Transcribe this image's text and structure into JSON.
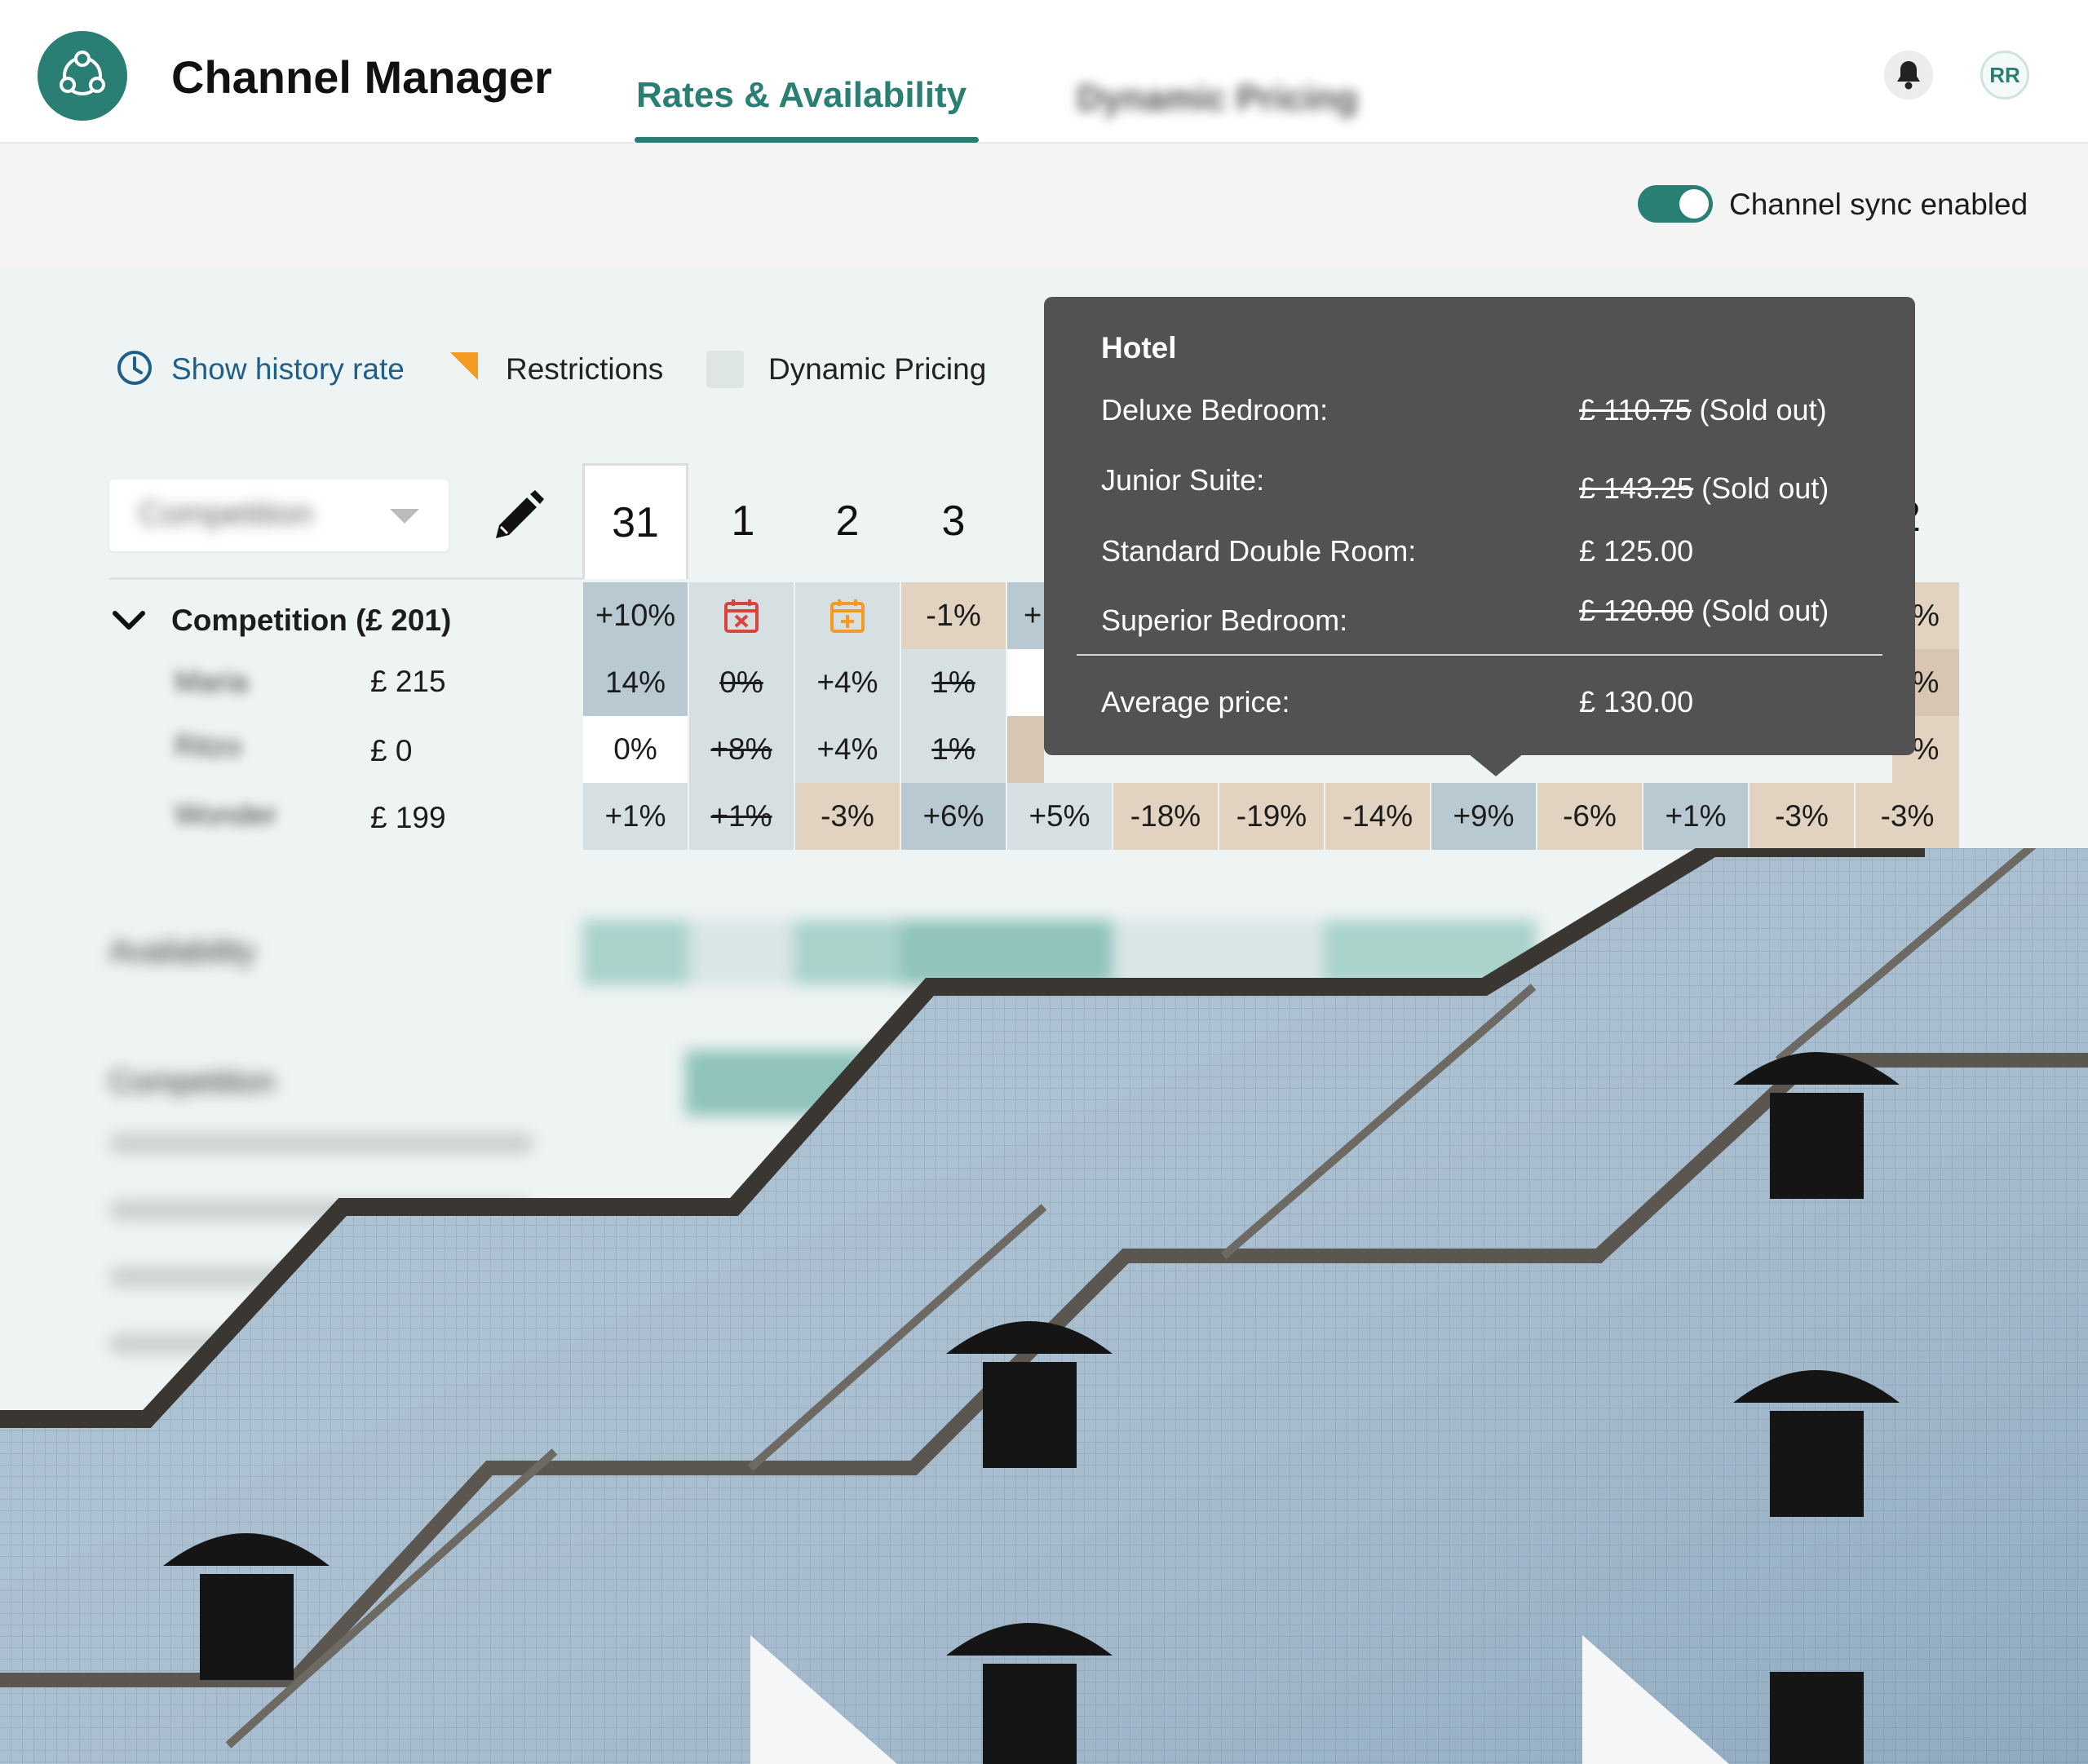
{
  "header": {
    "title": "Channel Manager",
    "tabs": [
      {
        "label": "Rates & Availability",
        "active": true
      },
      {
        "label": "Dynamic Pricing",
        "active": false,
        "blurred": true
      }
    ],
    "avatar_initials": "RR",
    "icons": [
      "logo-icon",
      "bell-icon"
    ]
  },
  "sync": {
    "label": "Channel sync enabled",
    "enabled": true
  },
  "legend": {
    "history": "Show history rate",
    "restrictions": "Restrictions",
    "dynamic_pricing": "Dynamic Pricing"
  },
  "grid": {
    "select_placeholder": "Competition",
    "dates": [
      "31",
      "1",
      "2",
      "3"
    ],
    "date_right_peek": "2",
    "competition_label": "Competition (£ 201)",
    "header_row": [
      "+10%",
      "restriction-closed-icon",
      "restriction-open-icon",
      "-1%",
      "+"
    ],
    "header_row_right_peek": "%",
    "competitors": [
      {
        "name": "Maria",
        "price": "£ 215",
        "cells": [
          "14%",
          "0%",
          "+4%",
          "1%"
        ],
        "right_peek": "%"
      },
      {
        "name": "Ritzo",
        "price": "£ 0",
        "cells": [
          "0%",
          "+8%",
          "+4%",
          "1%"
        ],
        "right_peek": "%"
      },
      {
        "name": "Wonder",
        "price": "£ 199",
        "cells": [
          "+1%",
          "+1%",
          "-3%",
          "+6%",
          "+5%",
          "-18%",
          "-19%",
          "-14%",
          "+9%",
          "-6%",
          "+1%",
          "-3%",
          "-3%"
        ]
      }
    ],
    "blurred_sections": [
      "Availability",
      "Competition"
    ],
    "colors": {
      "accent": "#2a7f75",
      "neutral": "#d6dfe1",
      "cool": "#b8c9d1",
      "warm": "#e2d2c0",
      "white": "#ffffff",
      "restriction_flag": "#f59a23",
      "closed_red": "#d9453d",
      "open_orange": "#f59a23"
    }
  },
  "tooltip": {
    "title": "Hotel",
    "rows": [
      {
        "label": "Deluxe Bedroom:",
        "price": "£ 110.75",
        "note": "(Sold out)",
        "sold_out": true
      },
      {
        "label": "Junior Suite:",
        "price": "£ 143.25",
        "note": "(Sold out)",
        "sold_out": true
      },
      {
        "label": "Standard Double Room:",
        "price": "£ 125.00",
        "note": "",
        "sold_out": false
      },
      {
        "label": "Superior Bedroom:",
        "price": "£ 120.00",
        "note": "(Sold out)",
        "sold_out": true
      }
    ],
    "average_label": "Average price:",
    "average_value": "£ 130.00"
  }
}
